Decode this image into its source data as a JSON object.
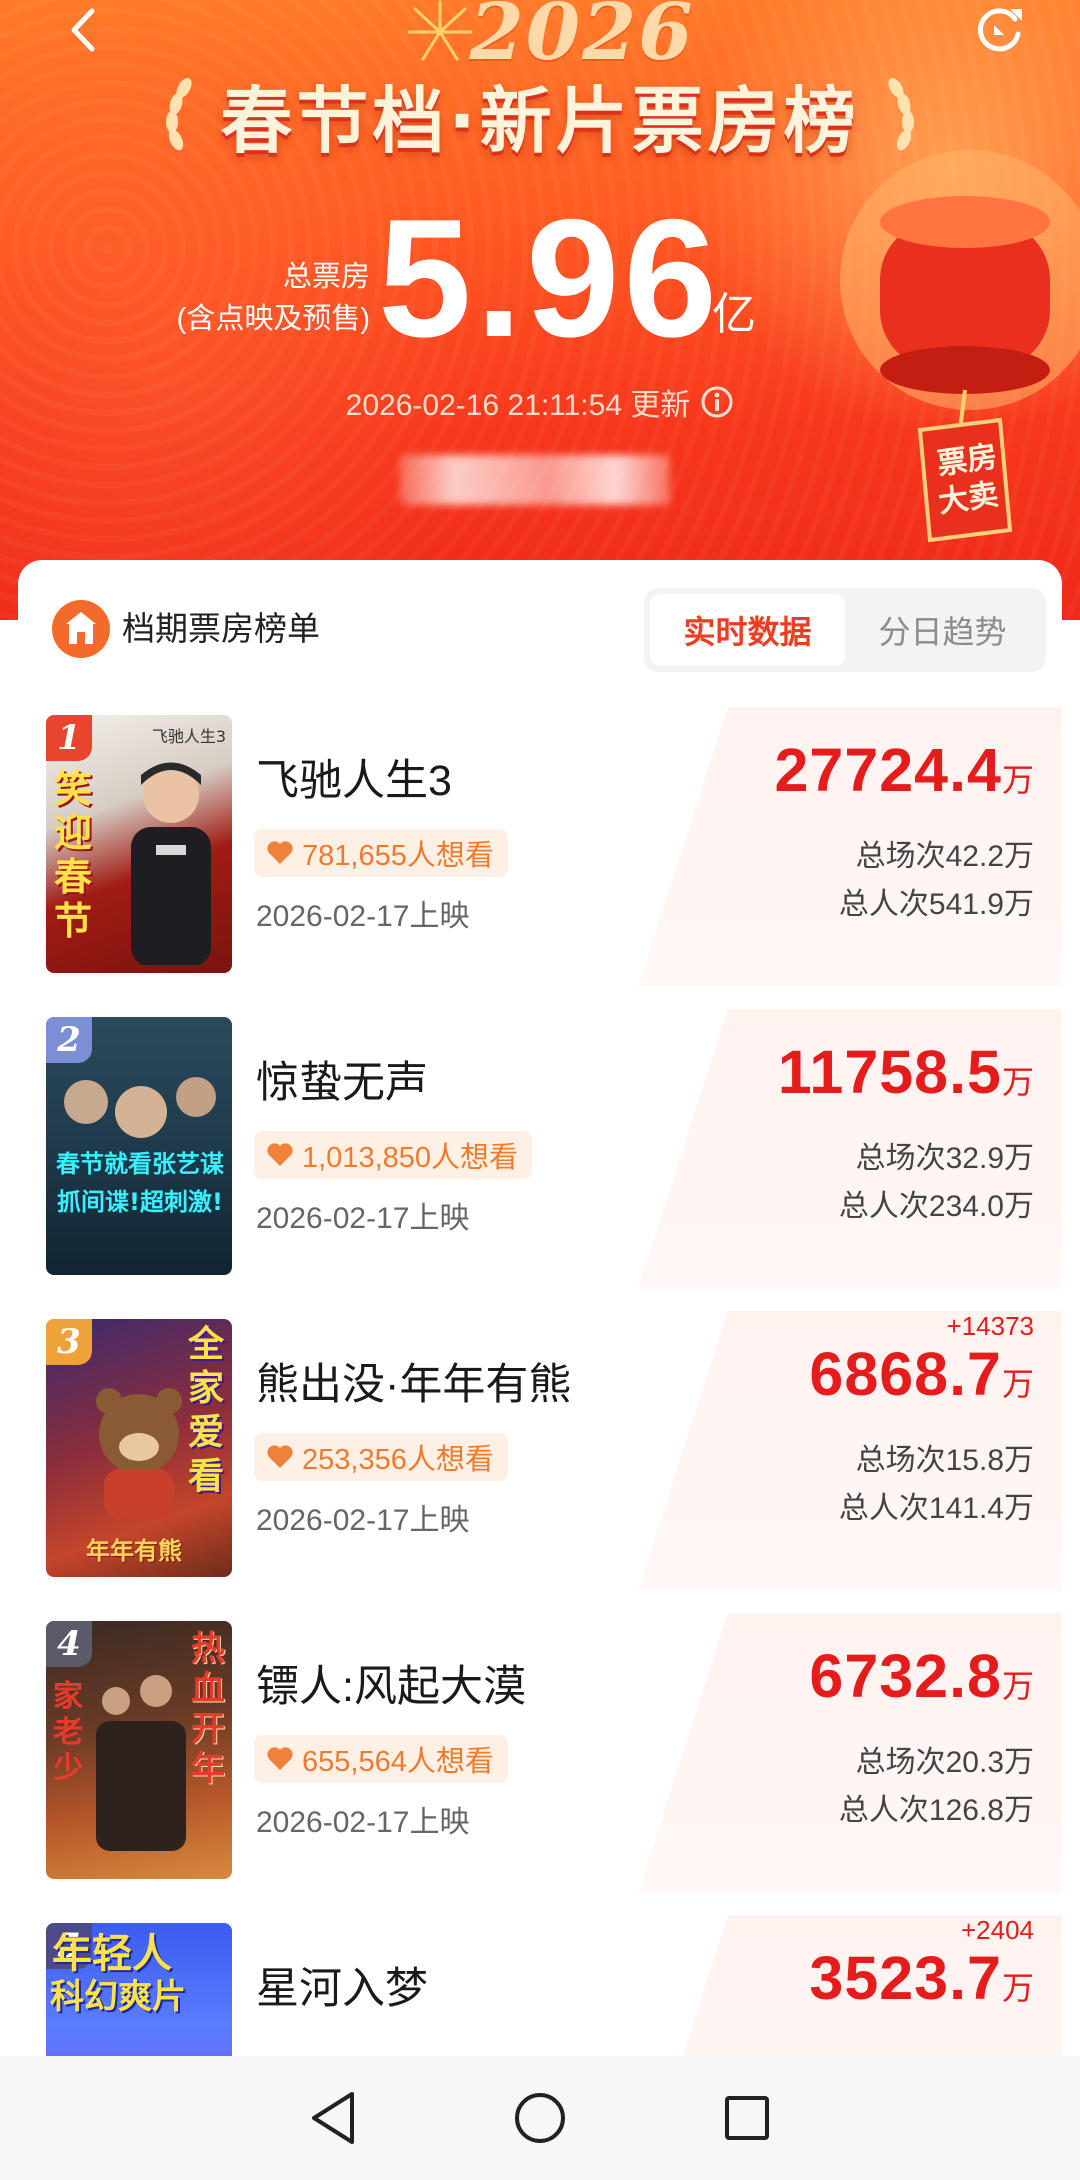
{
  "hero": {
    "year": "2026",
    "title": "春节档·新片票房榜",
    "total_label_line1": "总票房",
    "total_label_line2": "(含点映及预售)",
    "total_value": "5.96",
    "total_unit": "亿",
    "update_time": "2026-02-16 21:11:54 更新",
    "lantern_text": "票房大卖"
  },
  "panel": {
    "title": "档期票房榜单",
    "tabs": [
      {
        "label": "实时数据",
        "active": true
      },
      {
        "label": "分日趋势",
        "active": false
      }
    ]
  },
  "movies": [
    {
      "rank": "1",
      "title": "飞驰人生3",
      "want": "781,655人想看",
      "date": "2026-02-17上映",
      "box_office": "27724.4",
      "unit": "万",
      "delta": "",
      "sessions": "总场次42.2万",
      "viewers": "总人次541.9万",
      "poster_text": "笑迎春节",
      "poster_sub": "飞驰人生3"
    },
    {
      "rank": "2",
      "title": "惊蛰无声",
      "want": "1,013,850人想看",
      "date": "2026-02-17上映",
      "box_office": "11758.5",
      "unit": "万",
      "delta": "",
      "sessions": "总场次32.9万",
      "viewers": "总人次234.0万",
      "poster_text": "春节就看张艺谋",
      "poster_sub": "抓间谍!超刺激!"
    },
    {
      "rank": "3",
      "title": "熊出没·年年有熊",
      "want": "253,356人想看",
      "date": "2026-02-17上映",
      "box_office": "6868.7",
      "unit": "万",
      "delta": "+14373",
      "sessions": "总场次15.8万",
      "viewers": "总人次141.4万",
      "poster_text": "全家爱看",
      "poster_sub": "年年有熊"
    },
    {
      "rank": "4",
      "title": "镖人:风起大漠",
      "want": "655,564人想看",
      "date": "2026-02-17上映",
      "box_office": "6732.8",
      "unit": "万",
      "delta": "",
      "sessions": "总场次20.3万",
      "viewers": "总人次126.8万",
      "poster_text": "热血开年",
      "poster_sub": "家老少"
    },
    {
      "rank": "5",
      "title": "星河入梦",
      "want": "",
      "date": "",
      "box_office": "3523.7",
      "unit": "万",
      "delta": "+2404",
      "sessions": "",
      "viewers": "",
      "poster_text": "年轻人",
      "poster_sub": "科幻爽片"
    }
  ],
  "colors": {
    "accent": "#ef3d21",
    "box_red": "#e51c1c",
    "want_text": "#f07a2c",
    "want_bg": "#fff0e6"
  },
  "icons": {
    "back": "chevron-left-icon",
    "refresh": "refresh-icon",
    "info": "info-icon",
    "heart": "heart-icon",
    "nav_back": "triangle-back-icon",
    "nav_home": "circle-home-icon",
    "nav_recent": "square-recent-icon"
  }
}
